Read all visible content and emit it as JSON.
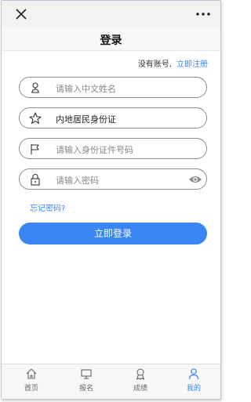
{
  "header": {
    "close_icon": "close-icon",
    "more_icon": "more-icon",
    "title": "登录"
  },
  "register": {
    "prompt": "没有账号,",
    "link": "立即注册"
  },
  "form": {
    "name_placeholder": "请输入中文姓名",
    "id_type_value": "内地居民身份证",
    "id_number_placeholder": "请输入身份证件号码",
    "password_placeholder": "请输入密码",
    "forgot_password": "忘记密码?",
    "submit_label": "立即登录"
  },
  "tabs": [
    {
      "label": "首页",
      "icon": "home-icon"
    },
    {
      "label": "报名",
      "icon": "monitor-icon"
    },
    {
      "label": "成绩",
      "icon": "award-icon"
    },
    {
      "label": "我的",
      "icon": "user-icon",
      "active": true
    }
  ],
  "colors": {
    "accent": "#3b86f5",
    "border": "#8e8e8e",
    "topbar": "#f2f2f2"
  }
}
